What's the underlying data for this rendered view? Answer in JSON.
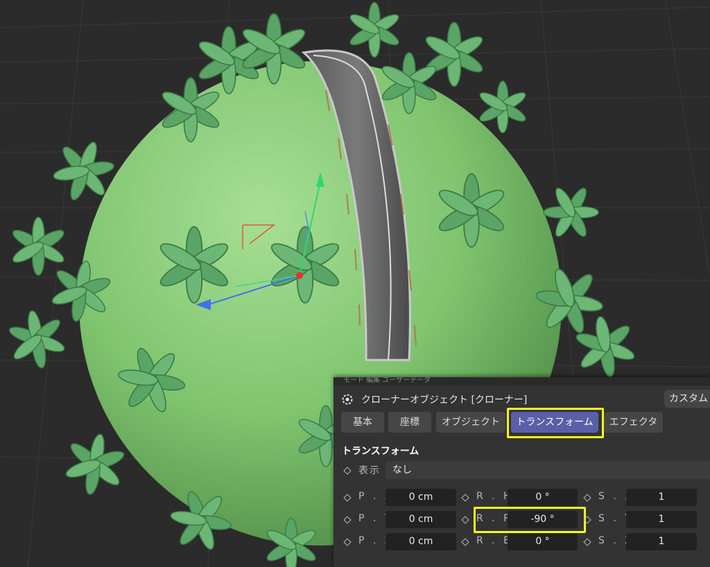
{
  "menu_strip": "モード  編集  ユーザーデータ",
  "object_title": "クローナーオブジェクト [クローナー]",
  "custom_label": "カスタム",
  "tabs": [
    {
      "label": "基本"
    },
    {
      "label": "座標"
    },
    {
      "label": "オブジェクト"
    },
    {
      "label": "トランスフォーム",
      "active": true
    },
    {
      "label": "エフェクタ"
    }
  ],
  "section_title": "トランスフォーム",
  "display": {
    "label": "表示",
    "value": "なし"
  },
  "params": {
    "px": {
      "label": "P . X",
      "value": "0 cm"
    },
    "py": {
      "label": "P . Y",
      "value": "0 cm"
    },
    "pz": {
      "label": "P . Z",
      "value": "0 cm"
    },
    "rh": {
      "label": "R . H",
      "value": "0 °"
    },
    "rp": {
      "label": "R . P",
      "value": "-90 °"
    },
    "rb": {
      "label": "R . B",
      "value": "0 °"
    },
    "sx": {
      "label": "S . X",
      "value": "1"
    },
    "sy": {
      "label": "S . Y",
      "value": "1"
    },
    "sz": {
      "label": "S . Z",
      "value": "1"
    }
  },
  "colors": {
    "highlight": "#f2ff1a",
    "active_tab": "#5b5fa8",
    "sphere": "#7fc46f",
    "palm": "#5aa566"
  },
  "icons": [
    "cloner-icon",
    "keyframe-diamond-icon"
  ]
}
